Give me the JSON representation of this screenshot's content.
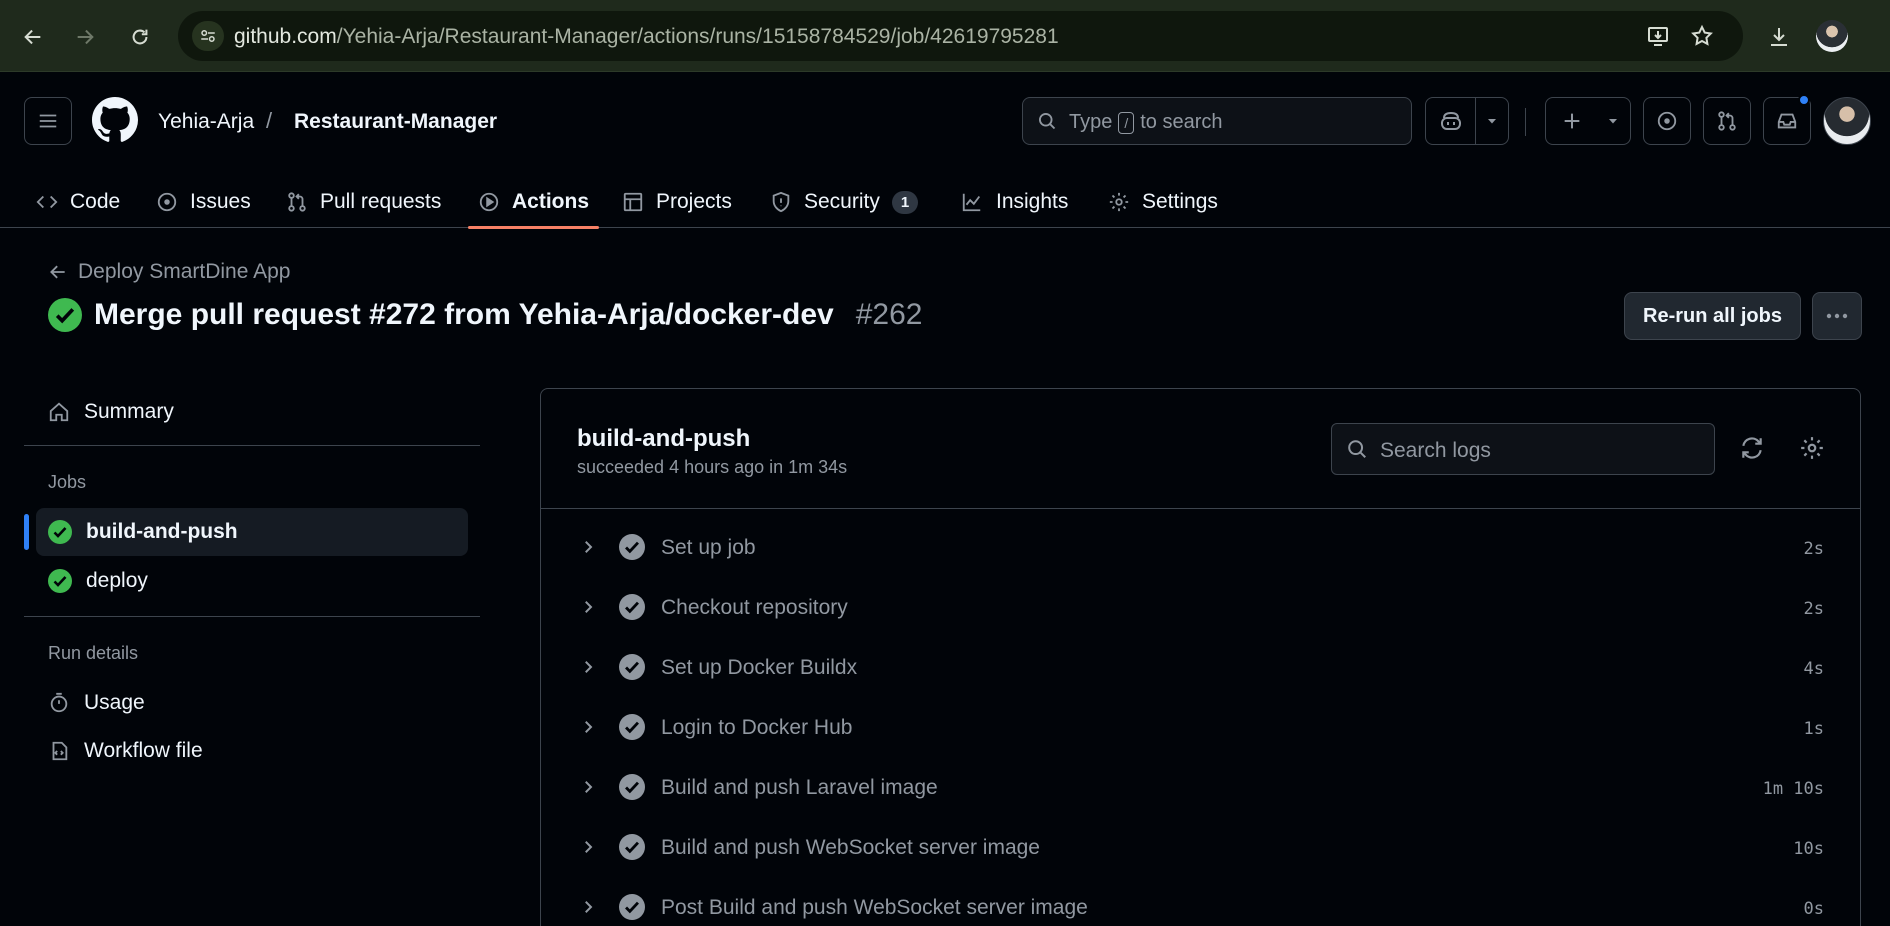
{
  "browser": {
    "url_domain": "github.com",
    "url_path": "/Yehia-Arja/Restaurant-Manager/actions/runs/15158784529/job/42619795281"
  },
  "header": {
    "owner": "Yehia-Arja",
    "separator": "/",
    "repo": "Restaurant-Manager",
    "search_type": "Type",
    "search_key": "/",
    "search_rest": "to search"
  },
  "tabs": [
    {
      "label": "Code"
    },
    {
      "label": "Issues"
    },
    {
      "label": "Pull requests"
    },
    {
      "label": "Actions"
    },
    {
      "label": "Projects"
    },
    {
      "label": "Security",
      "count": "1"
    },
    {
      "label": "Insights"
    },
    {
      "label": "Settings"
    }
  ],
  "run": {
    "workflow_back": "Deploy SmartDine App",
    "title": "Merge pull request #272 from Yehia-Arja/docker-dev",
    "number": "#262",
    "rerun_label": "Re-run all jobs"
  },
  "sidebar": {
    "summary": "Summary",
    "jobs_heading": "Jobs",
    "jobs": [
      {
        "label": "build-and-push"
      },
      {
        "label": "deploy"
      }
    ],
    "run_details_heading": "Run details",
    "usage": "Usage",
    "workflow_file": "Workflow file"
  },
  "job": {
    "name": "build-and-push",
    "status": "succeeded 4 hours ago in 1m 34s",
    "search_placeholder": "Search logs",
    "steps": [
      {
        "name": "Set up job",
        "duration": "2s"
      },
      {
        "name": "Checkout repository",
        "duration": "2s"
      },
      {
        "name": "Set up Docker Buildx",
        "duration": "4s"
      },
      {
        "name": "Login to Docker Hub",
        "duration": "1s"
      },
      {
        "name": "Build and push Laravel image",
        "duration": "1m 10s"
      },
      {
        "name": "Build and push WebSocket server image",
        "duration": "10s"
      },
      {
        "name": "Post Build and push WebSocket server image",
        "duration": "0s"
      }
    ]
  },
  "colors": {
    "success": "#3fb950",
    "accent_underline": "#f78166",
    "active_marker": "#2f81f7"
  }
}
